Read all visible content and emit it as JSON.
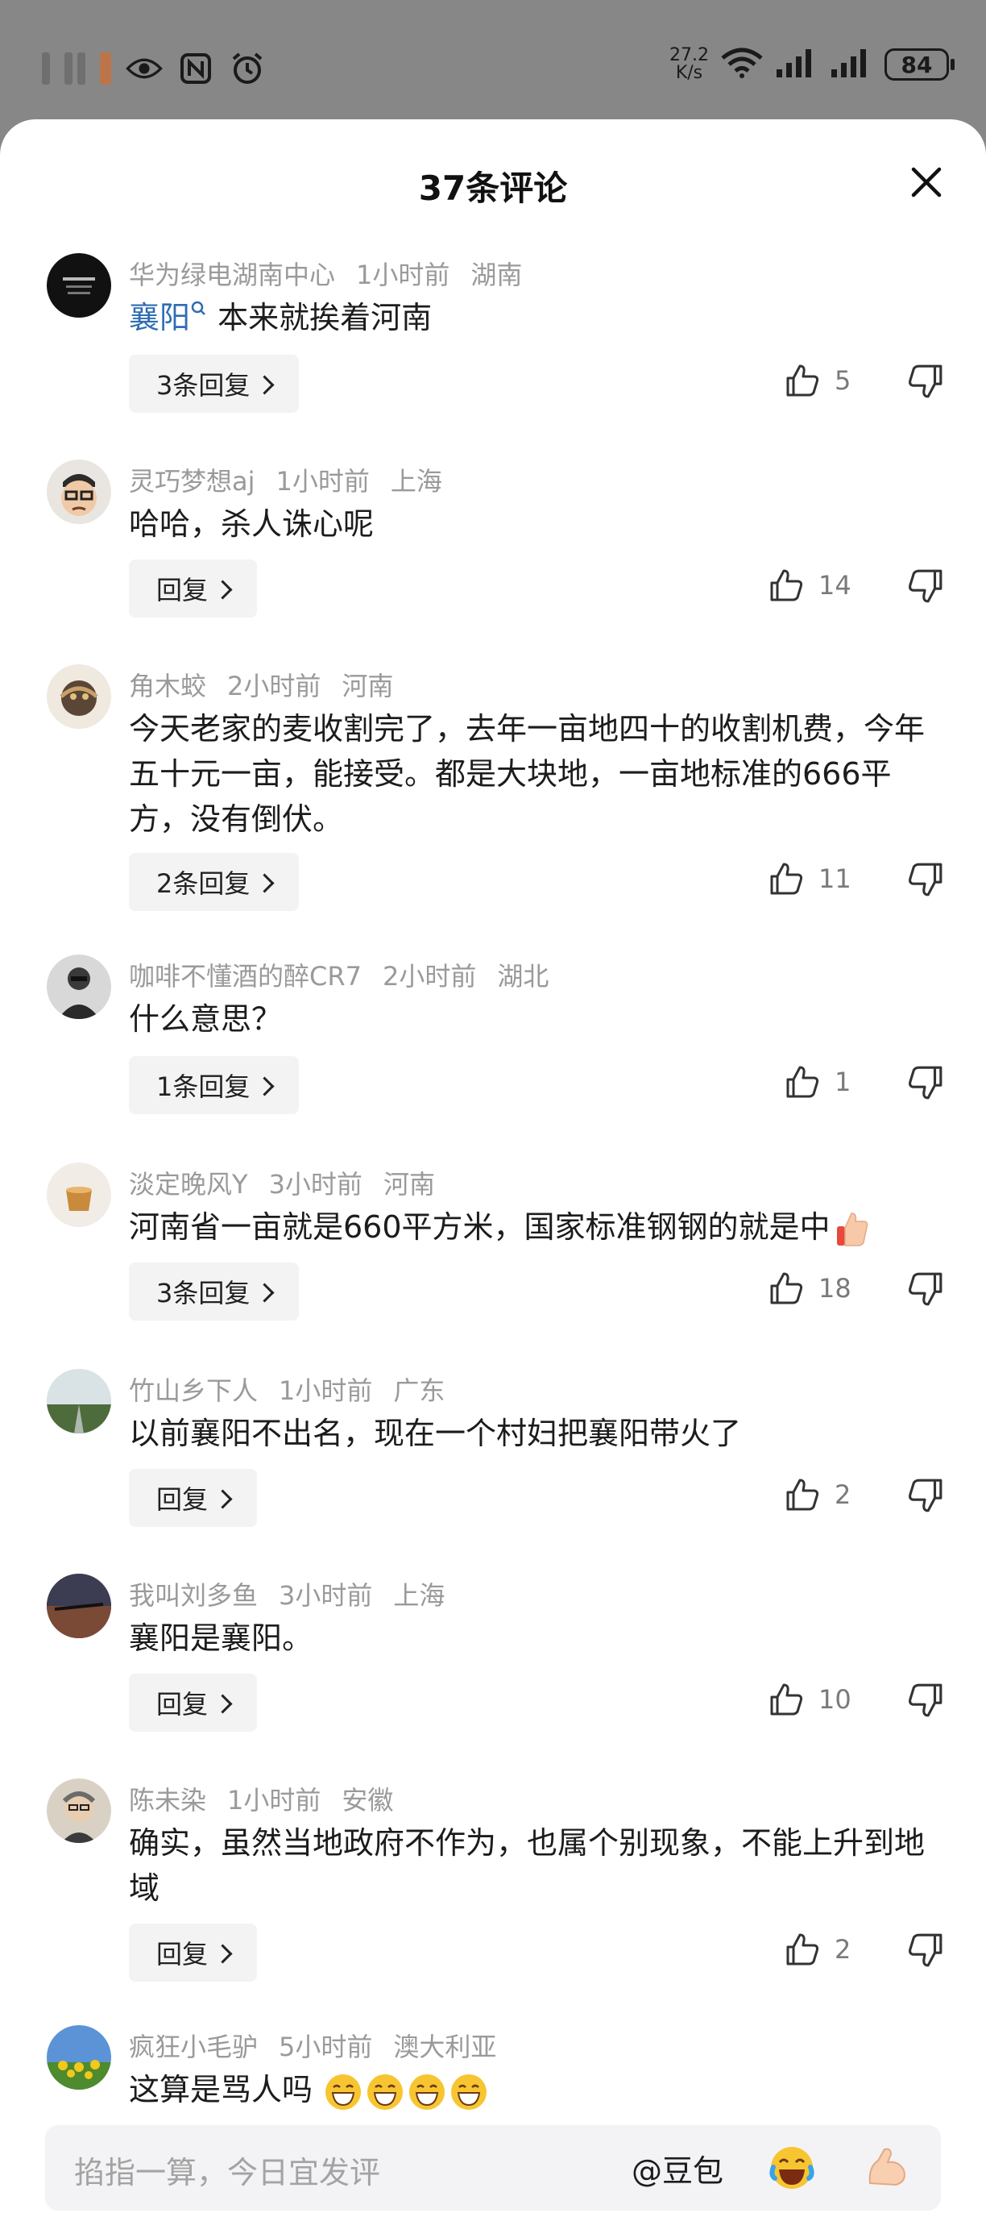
{
  "status_bar": {
    "net_speed_value": "27.2",
    "net_speed_unit": "K/s",
    "battery": "84"
  },
  "sheet": {
    "title": "37条评论"
  },
  "comments": [
    {
      "user": "华为绿电湖南中心",
      "time": "1小时前",
      "location": "湖南",
      "link": "襄阳",
      "text": "本来就挨着河南",
      "reply": "3条回复",
      "likes": "5"
    },
    {
      "user": "灵巧梦想aj",
      "time": "1小时前",
      "location": "上海",
      "text": "哈哈，杀人诛心呢",
      "reply": "回复",
      "likes": "14"
    },
    {
      "user": "角木蛟",
      "time": "2小时前",
      "location": "河南",
      "text": "今天老家的麦收割完了，去年一亩地四十的收割机费，今年五十元一亩，能接受。都是大块地，一亩地标准的666平方，没有倒伏。",
      "reply": "2条回复",
      "likes": "11"
    },
    {
      "user": "咖啡不懂酒的醉CR7",
      "time": "2小时前",
      "location": "湖北",
      "text": "什么意思？",
      "reply": "1条回复",
      "likes": "1"
    },
    {
      "user": "淡定晚风Y",
      "time": "3小时前",
      "location": "河南",
      "text": "河南省一亩就是660平方米，国家标准钢钢的就是中",
      "reply": "3条回复",
      "likes": "18"
    },
    {
      "user": "竹山乡下人",
      "time": "1小时前",
      "location": "广东",
      "text": "以前襄阳不出名，现在一个村妇把襄阳带火了",
      "reply": "回复",
      "likes": "2"
    },
    {
      "user": "我叫刘多鱼",
      "time": "3小时前",
      "location": "上海",
      "text": "襄阳是襄阳。",
      "reply": "回复",
      "likes": "10"
    },
    {
      "user": "陈未染",
      "time": "1小时前",
      "location": "安徽",
      "text": "确实，虽然当地政府不作为，也属个别现象，不能上升到地域",
      "reply": "回复",
      "likes": "2"
    },
    {
      "user": "疯狂小毛驴",
      "time": "5小时前",
      "location": "澳大利亚",
      "text": "这算是骂人吗"
    }
  ],
  "input_bar": {
    "placeholder": "掐指一算，今日宜发评",
    "at_label": "@豆包"
  }
}
